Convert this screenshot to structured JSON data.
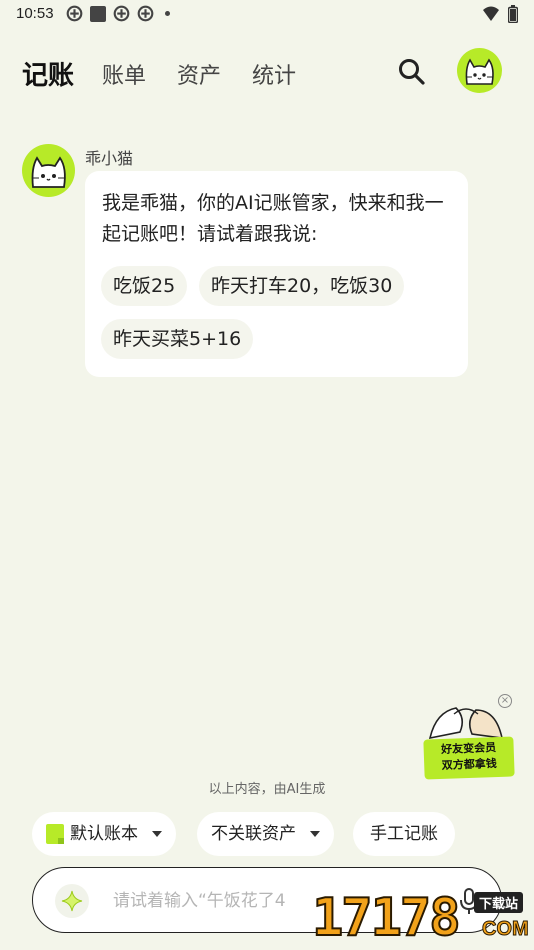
{
  "status_bar": {
    "time": "10:53",
    "left_icons": [
      "app-notification-icon",
      "square-icon",
      "app-notification-icon",
      "app-notification-icon",
      "dot-icon"
    ],
    "right_icons": [
      "wifi-icon",
      "battery-icon"
    ]
  },
  "nav": {
    "tabs": [
      {
        "label": "记账",
        "active": true
      },
      {
        "label": "账单",
        "active": false
      },
      {
        "label": "资产",
        "active": false
      },
      {
        "label": "统计",
        "active": false
      }
    ],
    "search_icon": "search-icon",
    "avatar_icon": "cat-avatar-icon"
  },
  "chat": {
    "bot_name": "乖小猫",
    "message": "我是乖猫，你的AI记账管家，快来和我一起记账吧！请试着跟我说:",
    "suggestions": [
      "吃饭25",
      "昨天打车20，吃饭30",
      "昨天买菜5+16"
    ]
  },
  "promo": {
    "line1": "好友变会员",
    "line2": "双方都拿钱",
    "close_icon": "close-icon"
  },
  "ai_note": "以上内容，由AI生成",
  "actions": {
    "account_book": "默认账本",
    "asset": "不关联资产",
    "manual": "手工记账"
  },
  "input": {
    "placeholder": "请试着输入“午饭花了4",
    "sparkle_icon": "sparkle-icon",
    "mic_icon": "microphone-icon"
  },
  "watermark": {
    "number": "17178",
    "tag": "下载站",
    "suffix": "COM"
  },
  "colors": {
    "accent": "#b7ea28",
    "background": "#f3f5ea",
    "card": "#ffffff"
  }
}
